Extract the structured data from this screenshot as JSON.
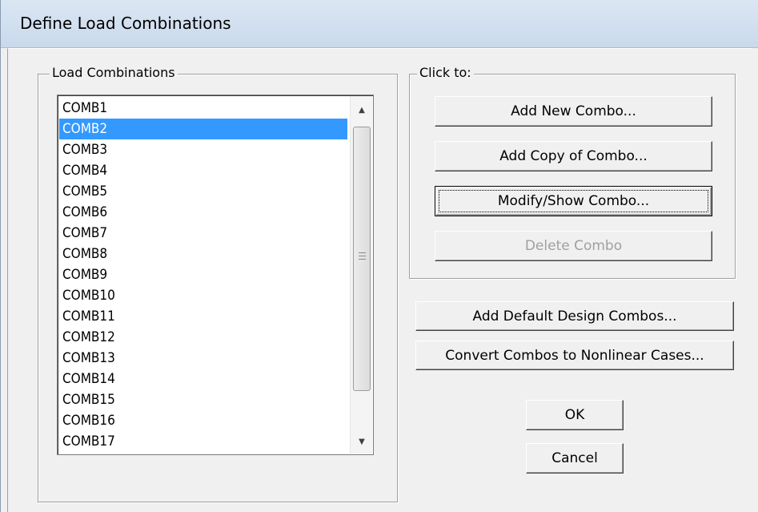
{
  "window": {
    "title": "Define Load Combinations"
  },
  "combos_group": {
    "legend": "Load Combinations",
    "items": [
      "COMB1",
      "COMB2",
      "COMB3",
      "COMB4",
      "COMB5",
      "COMB6",
      "COMB7",
      "COMB8",
      "COMB9",
      "COMB10",
      "COMB11",
      "COMB12",
      "COMB13",
      "COMB14",
      "COMB15",
      "COMB16",
      "COMB17"
    ],
    "selected": "COMB2"
  },
  "click_group": {
    "legend": "Click to:",
    "add_new": "Add New Combo...",
    "add_copy": "Add Copy of Combo...",
    "modify_show": "Modify/Show Combo...",
    "delete": "Delete Combo"
  },
  "actions": {
    "add_default": "Add Default Design Combos...",
    "convert": "Convert Combos to Nonlinear Cases..."
  },
  "dialog_buttons": {
    "ok": "OK",
    "cancel": "Cancel"
  },
  "icons": {
    "scroll_up": "scroll-up-icon",
    "scroll_down": "scroll-down-icon",
    "scroll_grip": "scroll-grip-icon"
  },
  "colors": {
    "selection": "#3399ff",
    "disabled_text": "#a0a0a0"
  }
}
